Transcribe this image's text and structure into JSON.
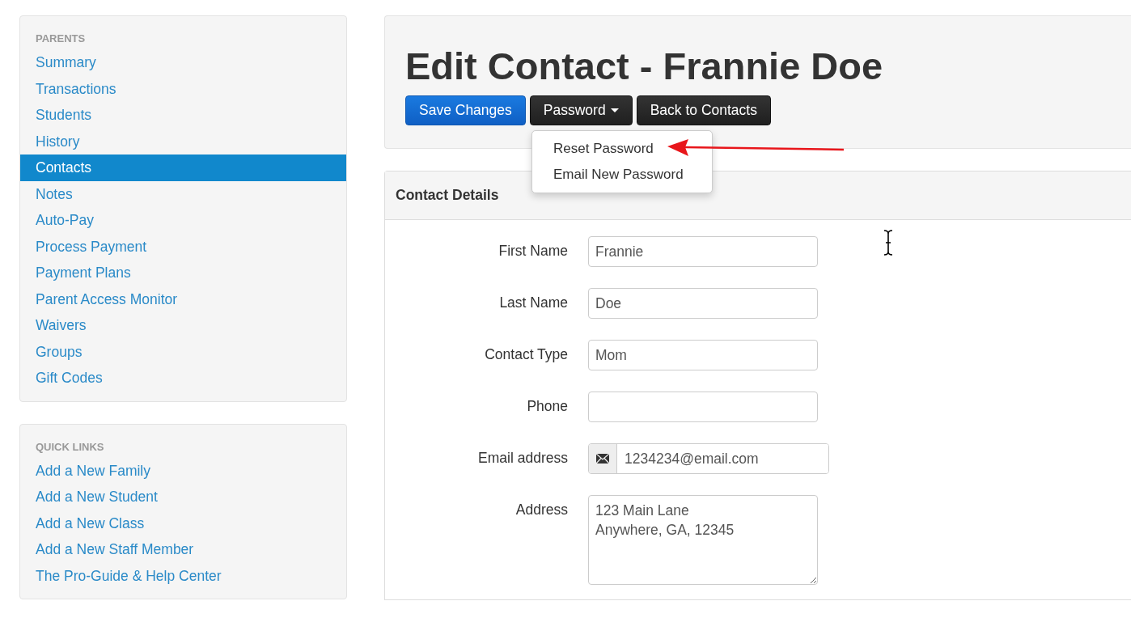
{
  "sidebar": [
    {
      "heading": "PARENTS",
      "items": [
        {
          "label": "Summary",
          "selected": false
        },
        {
          "label": "Transactions",
          "selected": false
        },
        {
          "label": "Students",
          "selected": false
        },
        {
          "label": "History",
          "selected": false
        },
        {
          "label": "Contacts",
          "selected": true
        },
        {
          "label": "Notes",
          "selected": false
        },
        {
          "label": "Auto-Pay",
          "selected": false
        },
        {
          "label": "Process Payment",
          "selected": false
        },
        {
          "label": "Payment Plans",
          "selected": false
        },
        {
          "label": "Parent Access Monitor",
          "selected": false
        },
        {
          "label": "Waivers",
          "selected": false
        },
        {
          "label": "Groups",
          "selected": false
        },
        {
          "label": "Gift Codes",
          "selected": false
        }
      ]
    },
    {
      "heading": "QUICK LINKS",
      "items": [
        {
          "label": "Add a New Family",
          "selected": false
        },
        {
          "label": "Add a New Student",
          "selected": false
        },
        {
          "label": "Add a New Class",
          "selected": false
        },
        {
          "label": "Add a New Staff Member",
          "selected": false
        },
        {
          "label": "The Pro-Guide & Help Center",
          "selected": false
        }
      ]
    }
  ],
  "page_title": "Edit Contact - Frannie Doe",
  "buttons": [
    {
      "label": "Save Changes",
      "kind": "primary"
    },
    {
      "label": "Password",
      "kind": "dropdown"
    },
    {
      "label": "Back to Contacts",
      "kind": "dark"
    }
  ],
  "dropdown_menu": [
    "Reset Password",
    "Email New Password"
  ],
  "panel_title": "Contact Details",
  "fields": [
    {
      "label": "First Name",
      "value": "Frannie",
      "kind": "text"
    },
    {
      "label": "Last Name",
      "value": "Doe",
      "kind": "text"
    },
    {
      "label": "Contact Type",
      "value": "Mom",
      "kind": "text"
    },
    {
      "label": "Phone",
      "kind": "text"
    },
    {
      "label": "Email address",
      "value": "1234234@email.com",
      "kind": "email"
    },
    {
      "label": "Address",
      "value": "123 Main Lane\nAnywhere, GA, 12345",
      "kind": "textarea"
    }
  ]
}
